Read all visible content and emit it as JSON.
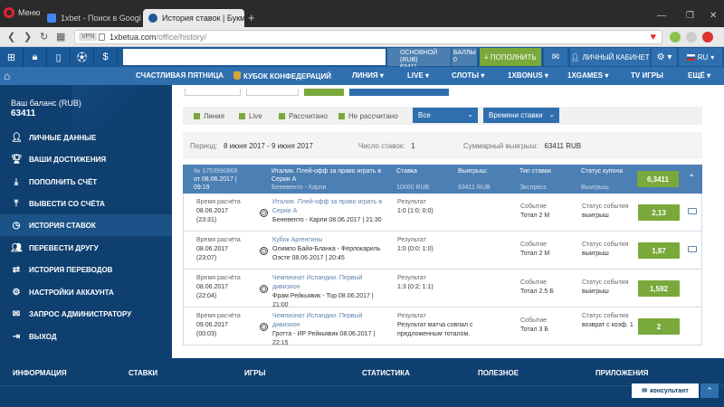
{
  "browser": {
    "menu_label": "Меню",
    "tabs": [
      {
        "title": "1xbet - Поиск в Google",
        "active": false
      },
      {
        "title": "История ставок | Букмек",
        "active": true
      }
    ],
    "url_domain": "1xbetua.com",
    "url_path": "/office/history/",
    "vpn_label": "VPN"
  },
  "topbar": {
    "account_main_title": "ОСНОВНОЙ (RUB)",
    "account_main_value": "63411",
    "account_bonus_title": "БАЛЛЫ",
    "account_bonus_value": "0",
    "deposit_label": "ПОПОЛНИТЬ",
    "cabinet_label": "ЛИЧНЫЙ КАБИНЕТ",
    "language": "RU"
  },
  "nav": {
    "items": [
      "СЧАСТЛИВАЯ ПЯТНИЦА",
      "КУБОК КОНФЕДЕРАЦИЙ",
      "ЛИНИЯ ▾",
      "LIVE ▾",
      "СЛОТЫ ▾",
      "1XBONUS ▾",
      "1XGAMES ▾",
      "TV ИГРЫ",
      "ЕЩЁ ▾"
    ]
  },
  "sidebar": {
    "balance_label": "Ваш баланс (RUB)",
    "balance_value": "63411",
    "items": [
      {
        "label": "ЛИЧНЫЕ ДАННЫЕ",
        "icon": "user-icon"
      },
      {
        "label": "ВАШИ ДОСТИЖЕНИЯ",
        "icon": "trophy-icon"
      },
      {
        "label": "ПОПОЛНИТЬ СЧЁТ",
        "icon": "download-icon"
      },
      {
        "label": "ВЫВЕСТИ СО СЧЁТА",
        "icon": "upload-icon"
      },
      {
        "label": "ИСТОРИЯ СТАВОК",
        "icon": "clock-icon",
        "active": true
      },
      {
        "label": "ПЕРЕВЕСТИ ДРУГУ",
        "icon": "users-icon"
      },
      {
        "label": "ИСТОРИЯ ПЕРЕВОДОВ",
        "icon": "transfer-icon"
      },
      {
        "label": "НАСТРОЙКИ АККАУНТА",
        "icon": "gear-icon"
      },
      {
        "label": "ЗАПРОС АДМИНИСТРАТОРУ",
        "icon": "mail-icon"
      },
      {
        "label": "ВЫХОД",
        "icon": "logout-icon"
      }
    ]
  },
  "filters": {
    "checkboxes": [
      "Линия",
      "Live",
      "Рассчитано",
      "Не рассчитано"
    ],
    "select_type": "Все",
    "select_sort": "Времени ставки"
  },
  "summary": {
    "period_label": "Период:",
    "period_value": "8 июня 2017 - 9 июня 2017",
    "count_label": "Число ставок:",
    "count_value": "1",
    "total_win_label": "Суммарный выигрыш:",
    "total_win_value": "63411 RUB"
  },
  "coupon": {
    "number": "№ 1753990869",
    "date": "от 08.06.2017 | 09:19",
    "event_line1": "Италия. Плей-офф за право играть в Серии А",
    "event_line2": "Беневенто - Карпи",
    "stake_label": "Ставка",
    "stake_value": "10000 RUB",
    "win_label": "Выигрыш:",
    "win_value": "63411 RUB",
    "type_label": "Тип ставки",
    "type_value": "Экспресс",
    "status_label": "Статус купона",
    "status_value": "Выигрыш",
    "coef": "6,3411"
  },
  "events": [
    {
      "time_label": "Время расчёта",
      "date": "08.06.2017",
      "time": "(23:31)",
      "league": "Италия. Плей-офф за право играть в Серии А",
      "match": "Беневенто - Карпи 08.06.2017 | 21:30",
      "result_label": "Результат",
      "result": "1:0 (1:0; 0:0)",
      "event_label": "Событие",
      "event": "Тотал 2 М",
      "status_label": "Статус события",
      "status": "выигрыш",
      "coef": "2,13",
      "tv": true
    },
    {
      "time_label": "Время расчёта",
      "date": "08.06.2017",
      "time": "(23:07)",
      "league": "Кубок Аргентины",
      "match": "Олимпо Байя-Бланка - Ферлокариль Оэсте 08.06.2017 | 20:45",
      "result_label": "Результат",
      "result": "1:0 (0:0; 1:0)",
      "event_label": "Событие",
      "event": "Тотал 2 М",
      "status_label": "Статус события",
      "status": "выигрыш",
      "coef": "1,87",
      "tv": true
    },
    {
      "time_label": "Время расчёта",
      "date": "08.06.2017",
      "time": "(22:04)",
      "league": "Чемпионат Исландии. Первый дивизион",
      "match": "Фрам Рейкьявик - Тор 08.06.2017 | 21:00",
      "result_label": "Результат",
      "result": "1:3 (0:2; 1:1)",
      "event_label": "Событие",
      "event": "Тотал 2.5 Б",
      "status_label": "Статус события",
      "status": "выигрыш",
      "coef": "1,592",
      "tv": false
    },
    {
      "time_label": "Время расчёта",
      "date": "09.06.2017",
      "time": "(00:03)",
      "league": "Чемпионат Исландии. Первый дивизион",
      "match": "Гротта - ИР Рейкьявик 08.06.2017 | 22:15",
      "result_label": "Результат",
      "result": "Результат матча совпал с предложенным тоталом.",
      "event_label": "Событие",
      "event": "Тотал 3 Б",
      "status_label": "Статус события",
      "status": "возврат с коэф. 1",
      "coef": "2",
      "tv": false
    }
  ],
  "footer": {
    "items": [
      "ИНФОРМАЦИЯ",
      "СТАВКИ",
      "ИГРЫ",
      "СТАТИСТИКА",
      "ПОЛЕЗНОЕ",
      "ПРИЛОЖЕНИЯ"
    ],
    "consultant_label": "консультант"
  }
}
